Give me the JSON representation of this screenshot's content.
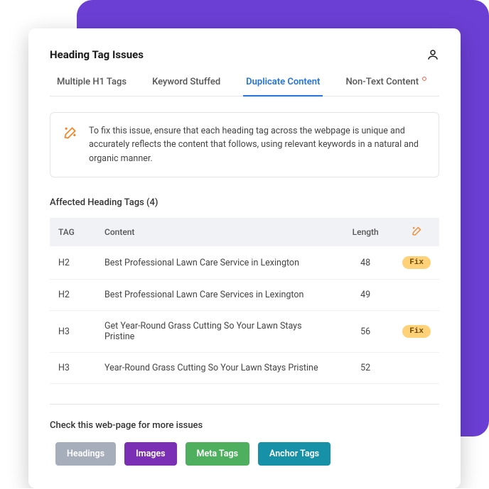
{
  "title": "Heading Tag Issues",
  "tabs": [
    {
      "label": "Multiple H1 Tags",
      "active": false,
      "badge": false
    },
    {
      "label": "Keyword Stuffed",
      "active": false,
      "badge": false
    },
    {
      "label": "Duplicate Content",
      "active": true,
      "badge": false
    },
    {
      "label": "Non-Text Content",
      "active": false,
      "badge": true
    }
  ],
  "tip": "To fix this issue, ensure that each heading tag across the webpage is unique and accurately reflects the content that follows, using relevant keywords in a natural and organic manner.",
  "affected": {
    "title": "Affected Heading Tags (4)",
    "columns": {
      "tag": "TAG",
      "content": "Content",
      "length": "Length"
    },
    "rows": [
      {
        "tag": "H2",
        "content": "Best Professional Lawn Care Service in Lexington",
        "length": "48",
        "fix": true
      },
      {
        "tag": "H2",
        "content": "Best Professional Lawn Care Services in Lexington",
        "length": "49",
        "fix": false
      },
      {
        "tag": "H3",
        "content": "Get Year-Round Grass Cutting So Your Lawn Stays Pristine",
        "length": "56",
        "fix": true
      },
      {
        "tag": "H3",
        "content": "Year-Round Grass Cutting So Your Lawn Stays Pristine",
        "length": "52",
        "fix": false
      }
    ],
    "fix_label": "Fix"
  },
  "more_issues": {
    "title": "Check this web-page for more issues",
    "chips": [
      {
        "label": "Headings",
        "color": "#a6aebb"
      },
      {
        "label": "Images",
        "color": "#7b2fb5"
      },
      {
        "label": "Meta Tags",
        "color": "#4eaf5f"
      },
      {
        "label": "Anchor Tags",
        "color": "#1791a8"
      }
    ]
  }
}
